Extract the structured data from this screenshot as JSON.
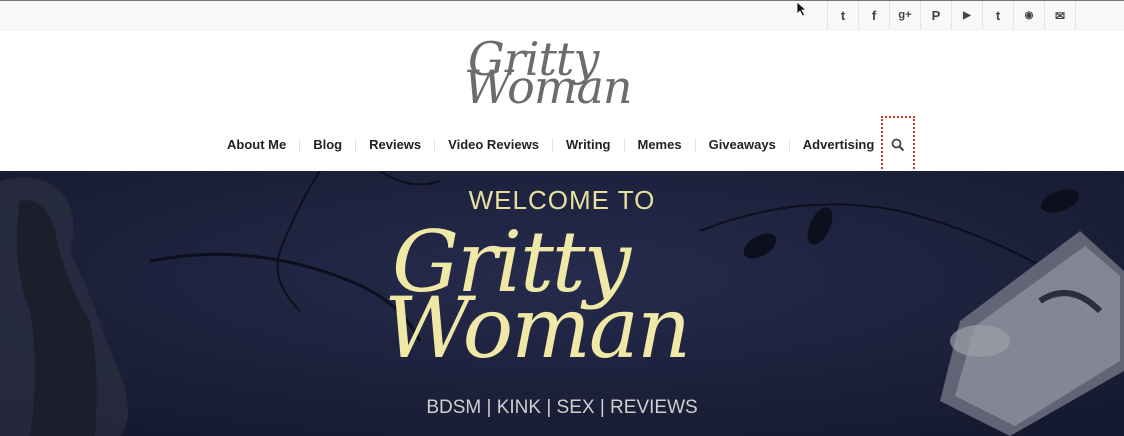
{
  "social": {
    "icons": [
      {
        "name": "twitter-icon",
        "glyph": "t"
      },
      {
        "name": "facebook-icon",
        "glyph": "f"
      },
      {
        "name": "google-plus-icon",
        "glyph": "g+"
      },
      {
        "name": "pinterest-icon",
        "glyph": "P"
      },
      {
        "name": "youtube-icon",
        "glyph": "▶"
      },
      {
        "name": "tumblr-icon",
        "glyph": "t"
      },
      {
        "name": "rss-icon",
        "glyph": "◉"
      },
      {
        "name": "mail-icon",
        "glyph": "✉"
      }
    ]
  },
  "logo": {
    "line1": "Gritty",
    "line2": "Woman"
  },
  "nav": {
    "items": [
      "About Me",
      "Blog",
      "Reviews",
      "Video Reviews",
      "Writing",
      "Memes",
      "Giveaways",
      "Advertising"
    ]
  },
  "hero": {
    "welcome": "WELCOME TO",
    "title_line1": "Gritty",
    "title_line2": "Woman",
    "tagline": "BDSM | KINK | SEX | REVIEWS"
  },
  "colors": {
    "hero_bg": "#1f2340",
    "hero_text": "#efe8a6",
    "logo_gray": "#6c6c6c"
  }
}
